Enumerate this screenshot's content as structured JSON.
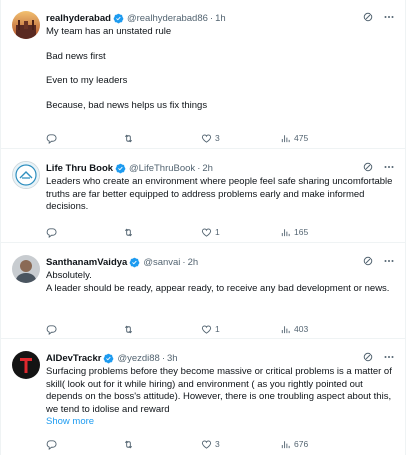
{
  "tweets": [
    {
      "name": "realhyderabad",
      "handle": "@realhyderabad86",
      "time": "1h",
      "lines": [
        "My team has an unstated rule",
        "Bad news first",
        "Even to my leaders",
        "Because, bad news helps us fix things"
      ],
      "show_more": "",
      "likes": "3",
      "views": "475"
    },
    {
      "name": "Life Thru Book",
      "handle": "@LifeThruBook",
      "time": "2h",
      "lines": [
        "Leaders who create an environment where people feel safe sharing uncomfortable truths are far better equipped to address problems early and make informed decisions."
      ],
      "show_more": "",
      "likes": "1",
      "views": "165"
    },
    {
      "name": "SanthanamVaidya",
      "handle": "@sanvai",
      "time": "2h",
      "lines": [
        "Absolutely.",
        "A leader should be ready, appear ready, to receive any bad development or news."
      ],
      "show_more": "",
      "likes": "1",
      "views": "403"
    },
    {
      "name": "AIDevTrackr",
      "handle": "@yezdi88",
      "time": "3h",
      "lines": [
        "Surfacing problems before they become massive or critical problems is a matter of skill( look out for it while hiring) and environment ( as you rightly pointed out depends on the boss's attitude). However, there is one troubling aspect about this, we tend to idolise and reward"
      ],
      "show_more": "Show more",
      "likes": "3",
      "views": "676"
    }
  ],
  "separator": "·",
  "colors": {
    "text": "#0f1419",
    "secondary": "#536471",
    "link": "#1d9bf0",
    "verified": "#1d9bf0",
    "border": "#eff3f4"
  },
  "icons": [
    "verified-badge-icon",
    "grok-icon",
    "more-icon",
    "reply-icon",
    "retweet-icon",
    "like-icon",
    "views-icon",
    "bookmark-icon",
    "share-icon"
  ]
}
